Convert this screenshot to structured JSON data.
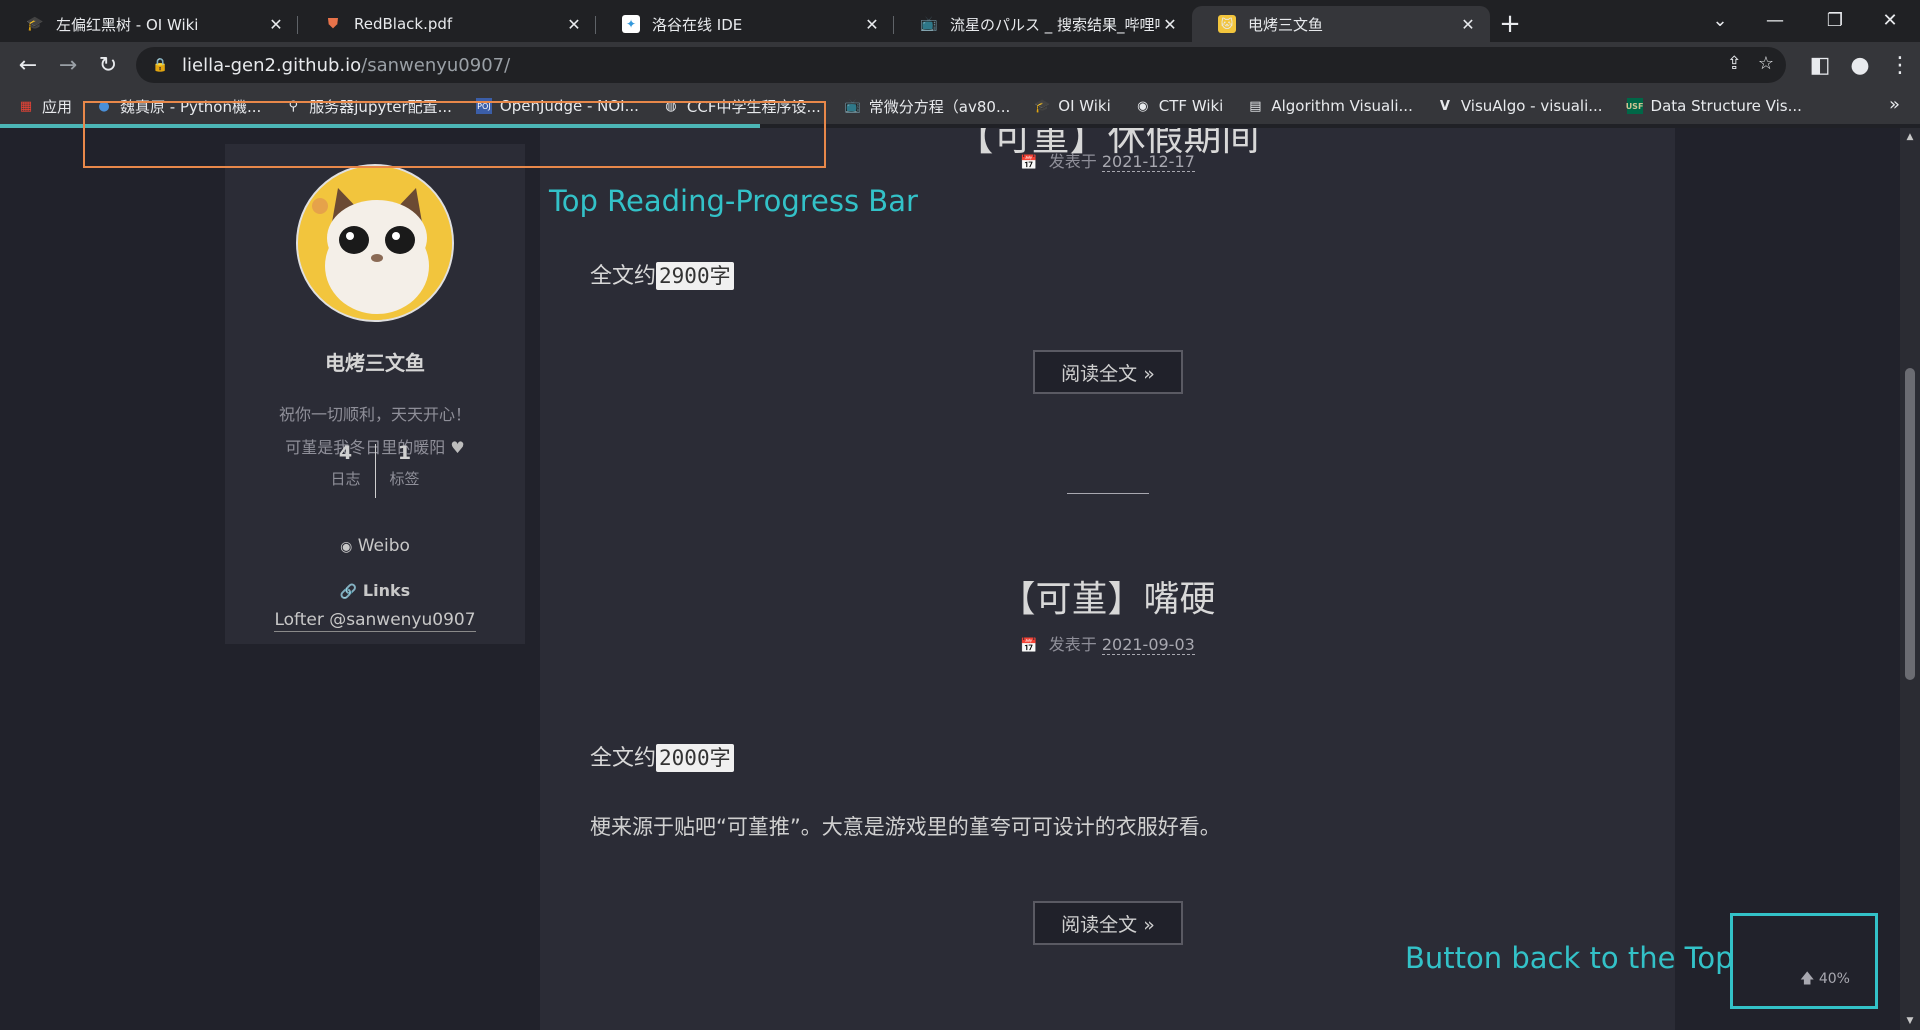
{
  "browser": {
    "tabs": [
      {
        "title": "左偏红黑树 - OI Wiki",
        "favicon": "graduation-cap-icon",
        "active": false
      },
      {
        "title": "RedBlack.pdf",
        "favicon": "shield-icon",
        "active": false
      },
      {
        "title": "洛谷在线 IDE",
        "favicon": "luogu-icon",
        "active": false
      },
      {
        "title": "流星のパルス _ 搜索结果_哔哩哔",
        "favicon": "bilibili-tv-icon",
        "active": false
      },
      {
        "title": "电烤三文鱼",
        "favicon": "cat-avatar-icon",
        "active": true
      }
    ],
    "url": {
      "host": "liella-gen2.github.io",
      "path": "/sanwenyu0907/"
    },
    "bookmarks": [
      {
        "label": "应用",
        "icon": "apps-grid-icon"
      },
      {
        "label": "魏真原 - Python機...",
        "icon": "circle-icon"
      },
      {
        "label": "服务器jupyter配置...",
        "icon": "link-icon"
      },
      {
        "label": "OpenJudge - NOI...",
        "icon": "poj-icon"
      },
      {
        "label": "CCF中学生程序设...",
        "icon": "globe-icon"
      },
      {
        "label": "常微分方程（av80...",
        "icon": "bilibili-tv-icon"
      },
      {
        "label": "OI Wiki",
        "icon": "graduation-cap-icon"
      },
      {
        "label": "CTF Wiki",
        "icon": "ctf-icon"
      },
      {
        "label": "Algorithm Visuali...",
        "icon": "algo-icon"
      },
      {
        "label": "VisuAlgo - visuali...",
        "icon": "visualgo-icon"
      },
      {
        "label": "Data Structure Vis...",
        "icon": "usf-icon"
      }
    ],
    "reading_progress": 0.4
  },
  "sidebar": {
    "author": "电烤三文鱼",
    "motto_line1": "祝你一切顺利，天天开心！",
    "motto_line2": "可堇是我冬日里的暖阳",
    "heart": "♥",
    "stats": [
      {
        "num": "4",
        "label": "日志"
      },
      {
        "num": "1",
        "label": "标签"
      }
    ],
    "weibo": "Weibo",
    "links_heading": "Links",
    "lofter": "Lofter @sanwenyu0907"
  },
  "posts": [
    {
      "title": "【可堇】休假期间",
      "date_prefix": "发表于",
      "date": "2021-12-17",
      "wc_prefix": "全文约",
      "wc_num": "2900",
      "wc_unit": "字",
      "read_more": "阅读全文 »"
    },
    {
      "title": "【可堇】嘴硬",
      "date_prefix": "发表于",
      "date": "2021-09-03",
      "wc_prefix": "全文约",
      "wc_num": "2000",
      "wc_unit": "字",
      "excerpt": "梗来源于贴吧“可堇推”。大意是游戏里的堇夸可可设计的衣服好看。",
      "read_more": "阅读全文 »"
    }
  ],
  "back_to_top": {
    "label": "40%"
  },
  "annotations": {
    "progress_label": "Top Reading-Progress Bar",
    "backtop_label": "Button back to the Top"
  }
}
